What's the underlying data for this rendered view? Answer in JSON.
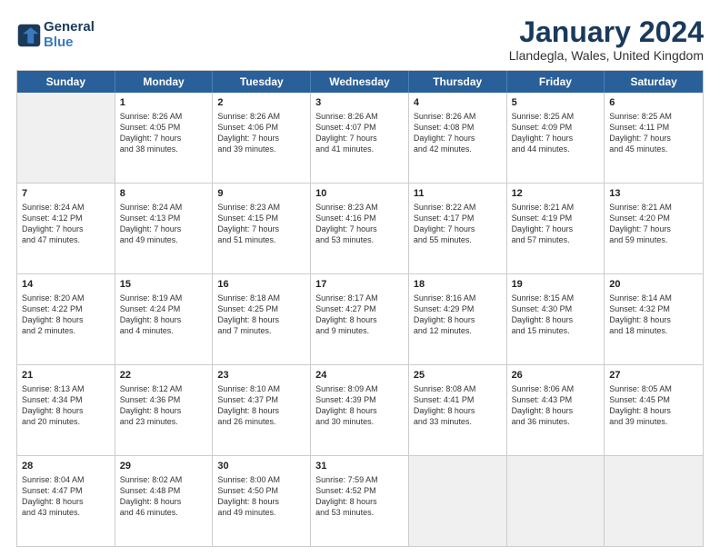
{
  "header": {
    "logo_line1": "General",
    "logo_line2": "Blue",
    "month_title": "January 2024",
    "location": "Llandegla, Wales, United Kingdom"
  },
  "weekdays": [
    "Sunday",
    "Monday",
    "Tuesday",
    "Wednesday",
    "Thursday",
    "Friday",
    "Saturday"
  ],
  "weeks": [
    [
      {
        "day": "",
        "lines": [],
        "shaded": true
      },
      {
        "day": "1",
        "lines": [
          "Sunrise: 8:26 AM",
          "Sunset: 4:05 PM",
          "Daylight: 7 hours",
          "and 38 minutes."
        ]
      },
      {
        "day": "2",
        "lines": [
          "Sunrise: 8:26 AM",
          "Sunset: 4:06 PM",
          "Daylight: 7 hours",
          "and 39 minutes."
        ]
      },
      {
        "day": "3",
        "lines": [
          "Sunrise: 8:26 AM",
          "Sunset: 4:07 PM",
          "Daylight: 7 hours",
          "and 41 minutes."
        ]
      },
      {
        "day": "4",
        "lines": [
          "Sunrise: 8:26 AM",
          "Sunset: 4:08 PM",
          "Daylight: 7 hours",
          "and 42 minutes."
        ]
      },
      {
        "day": "5",
        "lines": [
          "Sunrise: 8:25 AM",
          "Sunset: 4:09 PM",
          "Daylight: 7 hours",
          "and 44 minutes."
        ]
      },
      {
        "day": "6",
        "lines": [
          "Sunrise: 8:25 AM",
          "Sunset: 4:11 PM",
          "Daylight: 7 hours",
          "and 45 minutes."
        ]
      }
    ],
    [
      {
        "day": "7",
        "lines": [
          "Sunrise: 8:24 AM",
          "Sunset: 4:12 PM",
          "Daylight: 7 hours",
          "and 47 minutes."
        ],
        "shaded": true
      },
      {
        "day": "8",
        "lines": [
          "Sunrise: 8:24 AM",
          "Sunset: 4:13 PM",
          "Daylight: 7 hours",
          "and 49 minutes."
        ]
      },
      {
        "day": "9",
        "lines": [
          "Sunrise: 8:23 AM",
          "Sunset: 4:15 PM",
          "Daylight: 7 hours",
          "and 51 minutes."
        ]
      },
      {
        "day": "10",
        "lines": [
          "Sunrise: 8:23 AM",
          "Sunset: 4:16 PM",
          "Daylight: 7 hours",
          "and 53 minutes."
        ]
      },
      {
        "day": "11",
        "lines": [
          "Sunrise: 8:22 AM",
          "Sunset: 4:17 PM",
          "Daylight: 7 hours",
          "and 55 minutes."
        ]
      },
      {
        "day": "12",
        "lines": [
          "Sunrise: 8:21 AM",
          "Sunset: 4:19 PM",
          "Daylight: 7 hours",
          "and 57 minutes."
        ]
      },
      {
        "day": "13",
        "lines": [
          "Sunrise: 8:21 AM",
          "Sunset: 4:20 PM",
          "Daylight: 7 hours",
          "and 59 minutes."
        ]
      }
    ],
    [
      {
        "day": "14",
        "lines": [
          "Sunrise: 8:20 AM",
          "Sunset: 4:22 PM",
          "Daylight: 8 hours",
          "and 2 minutes."
        ],
        "shaded": true
      },
      {
        "day": "15",
        "lines": [
          "Sunrise: 8:19 AM",
          "Sunset: 4:24 PM",
          "Daylight: 8 hours",
          "and 4 minutes."
        ]
      },
      {
        "day": "16",
        "lines": [
          "Sunrise: 8:18 AM",
          "Sunset: 4:25 PM",
          "Daylight: 8 hours",
          "and 7 minutes."
        ]
      },
      {
        "day": "17",
        "lines": [
          "Sunrise: 8:17 AM",
          "Sunset: 4:27 PM",
          "Daylight: 8 hours",
          "and 9 minutes."
        ]
      },
      {
        "day": "18",
        "lines": [
          "Sunrise: 8:16 AM",
          "Sunset: 4:29 PM",
          "Daylight: 8 hours",
          "and 12 minutes."
        ]
      },
      {
        "day": "19",
        "lines": [
          "Sunrise: 8:15 AM",
          "Sunset: 4:30 PM",
          "Daylight: 8 hours",
          "and 15 minutes."
        ]
      },
      {
        "day": "20",
        "lines": [
          "Sunrise: 8:14 AM",
          "Sunset: 4:32 PM",
          "Daylight: 8 hours",
          "and 18 minutes."
        ]
      }
    ],
    [
      {
        "day": "21",
        "lines": [
          "Sunrise: 8:13 AM",
          "Sunset: 4:34 PM",
          "Daylight: 8 hours",
          "and 20 minutes."
        ],
        "shaded": true
      },
      {
        "day": "22",
        "lines": [
          "Sunrise: 8:12 AM",
          "Sunset: 4:36 PM",
          "Daylight: 8 hours",
          "and 23 minutes."
        ]
      },
      {
        "day": "23",
        "lines": [
          "Sunrise: 8:10 AM",
          "Sunset: 4:37 PM",
          "Daylight: 8 hours",
          "and 26 minutes."
        ]
      },
      {
        "day": "24",
        "lines": [
          "Sunrise: 8:09 AM",
          "Sunset: 4:39 PM",
          "Daylight: 8 hours",
          "and 30 minutes."
        ]
      },
      {
        "day": "25",
        "lines": [
          "Sunrise: 8:08 AM",
          "Sunset: 4:41 PM",
          "Daylight: 8 hours",
          "and 33 minutes."
        ]
      },
      {
        "day": "26",
        "lines": [
          "Sunrise: 8:06 AM",
          "Sunset: 4:43 PM",
          "Daylight: 8 hours",
          "and 36 minutes."
        ]
      },
      {
        "day": "27",
        "lines": [
          "Sunrise: 8:05 AM",
          "Sunset: 4:45 PM",
          "Daylight: 8 hours",
          "and 39 minutes."
        ]
      }
    ],
    [
      {
        "day": "28",
        "lines": [
          "Sunrise: 8:04 AM",
          "Sunset: 4:47 PM",
          "Daylight: 8 hours",
          "and 43 minutes."
        ],
        "shaded": true
      },
      {
        "day": "29",
        "lines": [
          "Sunrise: 8:02 AM",
          "Sunset: 4:48 PM",
          "Daylight: 8 hours",
          "and 46 minutes."
        ]
      },
      {
        "day": "30",
        "lines": [
          "Sunrise: 8:00 AM",
          "Sunset: 4:50 PM",
          "Daylight: 8 hours",
          "and 49 minutes."
        ]
      },
      {
        "day": "31",
        "lines": [
          "Sunrise: 7:59 AM",
          "Sunset: 4:52 PM",
          "Daylight: 8 hours",
          "and 53 minutes."
        ]
      },
      {
        "day": "",
        "lines": [],
        "shaded": true
      },
      {
        "day": "",
        "lines": [],
        "shaded": true
      },
      {
        "day": "",
        "lines": [],
        "shaded": true
      }
    ]
  ]
}
